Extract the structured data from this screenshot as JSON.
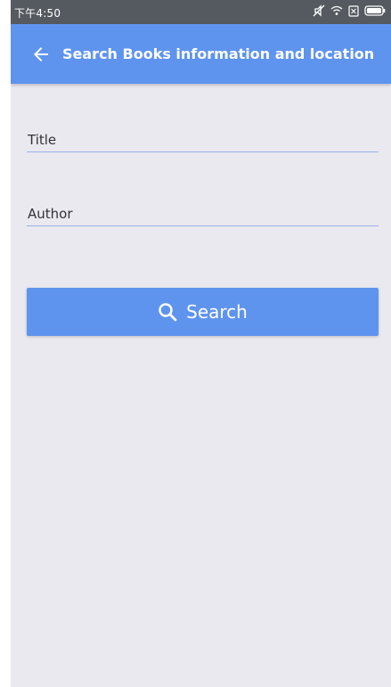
{
  "status_bar": {
    "time": "下午4:50",
    "icons": [
      "mute-icon",
      "wifi-icon",
      "sim-icon",
      "battery-icon"
    ]
  },
  "app_bar": {
    "title": "Search Books information and location",
    "back_icon": "arrow-back-icon",
    "color": "#5F94EE"
  },
  "form": {
    "title_field": {
      "placeholder": "Title",
      "value": ""
    },
    "author_field": {
      "placeholder": "Author",
      "value": ""
    }
  },
  "search_button": {
    "label": "Search",
    "icon": "search-icon",
    "color": "#5F94EE"
  },
  "colors": {
    "background": "#EAE9F0",
    "underline": "#98AFE6",
    "status_bar": "#555A60"
  }
}
